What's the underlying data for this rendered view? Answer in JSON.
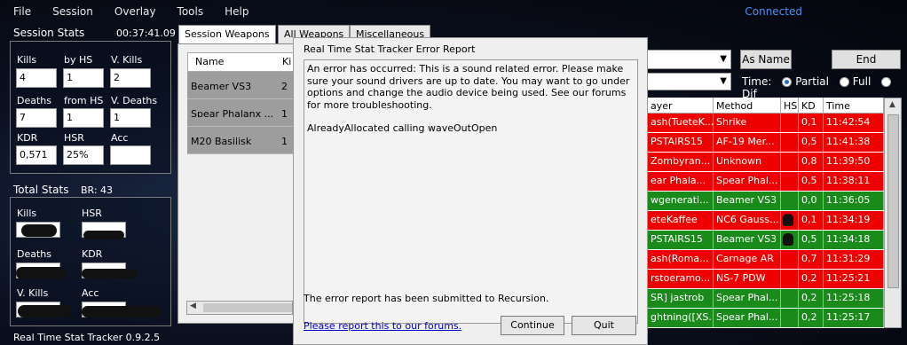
{
  "menu": [
    "File",
    "Session",
    "Overlay",
    "Tools",
    "Help"
  ],
  "status": "Connected",
  "session_stats": {
    "title": "Session Stats",
    "time": "00:37:41.09",
    "kills_label": "Kills",
    "kills": "4",
    "byhs_label": "by HS",
    "byhs": "1",
    "vkills_label": "V. Kills",
    "vkills": "2",
    "deaths_label": "Deaths",
    "deaths": "7",
    "fromhs_label": "from HS",
    "fromhs": "1",
    "vdeaths_label": "V. Deaths",
    "vdeaths": "1",
    "kdr_label": "KDR",
    "kdr": "0,571",
    "hsr_label": "HSR",
    "hsr": "25%",
    "acc_label": "Acc",
    "acc": ""
  },
  "total_stats": {
    "title": "Total Stats",
    "br": "BR: 43",
    "kills_label": "Kills",
    "hsr_label": "HSR",
    "deaths_label": "Deaths",
    "kdr_label": "KDR",
    "vkills_label": "V. Kills",
    "acc_label": "Acc"
  },
  "version": "Real Time Stat Tracker 0.9.2.5",
  "tabs": [
    "Session Weapons",
    "All Weapons",
    "Miscellaneous"
  ],
  "weapons": {
    "col_name": "Name",
    "col_kills": "Ki",
    "rows": [
      {
        "name": "Beamer VS3",
        "kills": "2"
      },
      {
        "name": "Spear Phalanx ...",
        "kills": "1"
      },
      {
        "name": "M20 Basilisk",
        "kills": "1"
      }
    ]
  },
  "dialog": {
    "title": "Real Time Stat Tracker Error Report",
    "message": "An error has occurred: This is a sound related error. Please make sure your sound drivers are up to date. You may want to go under options and change the audio device being used. See our forums for more troubleshooting.",
    "detail": "AlreadyAllocated calling waveOutOpen",
    "submitted": "The error report has been submitted to Recursion.",
    "link": "Please report this to our forums.",
    "continue": "Continue",
    "quit": "Quit"
  },
  "controls": {
    "as_name": "As Name",
    "end": "End",
    "time_label": "Time:",
    "partial": "Partial",
    "full": "Full",
    "dif": "Dif",
    "time_selected": "Partial"
  },
  "kills": {
    "headers": [
      "ayer",
      "Method",
      "HS",
      "KD",
      "Time"
    ],
    "rows": [
      {
        "player": "ash(TueteK...",
        "method": "Shrike",
        "hs": false,
        "kd": "0,1",
        "time": "11:42:54",
        "color": "red"
      },
      {
        "player": "PSTAIRS15",
        "method": "AF-19 Mer...",
        "hs": false,
        "kd": "0,5",
        "time": "11:41:38",
        "color": "red"
      },
      {
        "player": "Zombyran...",
        "method": "Unknown",
        "hs": false,
        "kd": "0,8",
        "time": "11:39:50",
        "color": "red"
      },
      {
        "player": "ear Phala...",
        "method": "Spear Phal...",
        "hs": false,
        "kd": "0,5",
        "time": "11:38:11",
        "color": "red"
      },
      {
        "player": "wgenerati...",
        "method": "Beamer VS3",
        "hs": false,
        "kd": "0,0",
        "time": "11:36:05",
        "color": "green"
      },
      {
        "player": "eteKaffee",
        "method": "NC6 Gauss...",
        "hs": true,
        "kd": "0,1",
        "time": "11:34:19",
        "color": "red"
      },
      {
        "player": "PSTAIRS15",
        "method": "Beamer VS3",
        "hs": true,
        "kd": "0,5",
        "time": "11:34:18",
        "color": "green"
      },
      {
        "player": "ash(Roma...",
        "method": "Carnage AR",
        "hs": false,
        "kd": "0,7",
        "time": "11:31:29",
        "color": "red"
      },
      {
        "player": "rstoeramo...",
        "method": "NS-7 PDW",
        "hs": false,
        "kd": "0,2",
        "time": "11:25:21",
        "color": "red"
      },
      {
        "player": "SR] jastrob",
        "method": "Spear Phal...",
        "hs": false,
        "kd": "0,2",
        "time": "11:25:18",
        "color": "green"
      },
      {
        "player": "ghtning([XS...",
        "method": "Spear Phal...",
        "hs": false,
        "kd": "0,2",
        "time": "11:25:17",
        "color": "green"
      }
    ]
  }
}
